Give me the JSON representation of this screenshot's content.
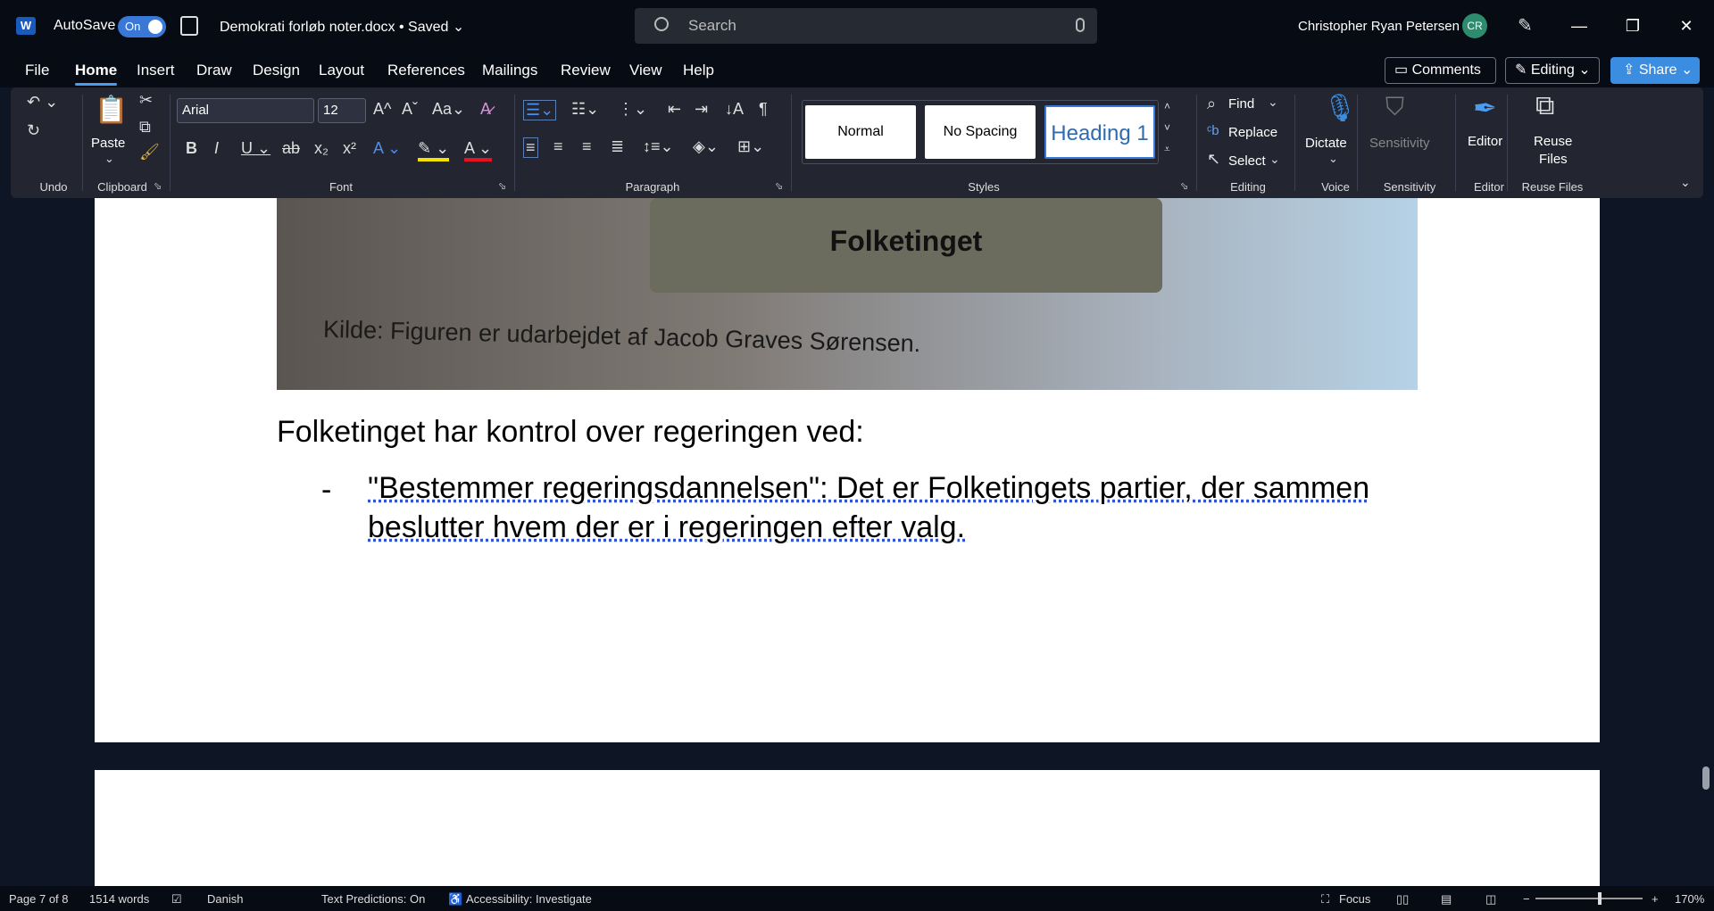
{
  "titlebar": {
    "app_letter": "W",
    "autosave_label": "AutoSave",
    "autosave_state": "On",
    "doc_title": "Demokrati forløb noter.docx • Saved ⌄",
    "search_placeholder": "Search",
    "user_name": "Christopher Ryan Petersen",
    "user_initials": "CR"
  },
  "menu": {
    "tabs": [
      "File",
      "Home",
      "Insert",
      "Draw",
      "Design",
      "Layout",
      "References",
      "Mailings",
      "Review",
      "View",
      "Help"
    ],
    "comments": "Comments",
    "editing": "Editing",
    "share": "Share"
  },
  "ribbon": {
    "groups": {
      "undo": "Undo",
      "clipboard": "Clipboard",
      "font": "Font",
      "paragraph": "Paragraph",
      "styles": "Styles",
      "editing": "Editing",
      "voice": "Voice",
      "sensitivity": "Sensitivity",
      "editor": "Editor",
      "reuse": "Reuse Files"
    },
    "paste": "Paste",
    "font_name": "Arial",
    "font_size": "12",
    "styles": [
      "Normal",
      "No Spacing",
      "Heading 1"
    ],
    "find": "Find",
    "replace": "Replace",
    "select": "Select",
    "dictate": "Dictate",
    "sensitivity": "Sensitivity",
    "editor": "Editor",
    "reuse_line1": "Reuse",
    "reuse_line2": "Files"
  },
  "document": {
    "image_box_text": "Folketinget",
    "image_caption": "Kilde: Figuren er udarbejdet af Jacob Graves Sørensen.",
    "heading": "Folketinget har kontrol over regeringen ved:",
    "bullet_marker": "-",
    "bullet_text": "\"Bestemmer regeringsdannelsen\": Det er Folketingets partier, der sammen beslutter hvem der er i regeringen efter valg."
  },
  "statusbar": {
    "page": "Page 7 of 8",
    "words": "1514 words",
    "language": "Danish",
    "text_predictions": "Text Predictions: On",
    "accessibility": "Accessibility: Investigate",
    "focus": "Focus",
    "zoom": "170%"
  },
  "colors": {
    "accent": "#3a8de0",
    "ribbon_bg": "#232630",
    "titlebar_bg": "#070b14"
  }
}
